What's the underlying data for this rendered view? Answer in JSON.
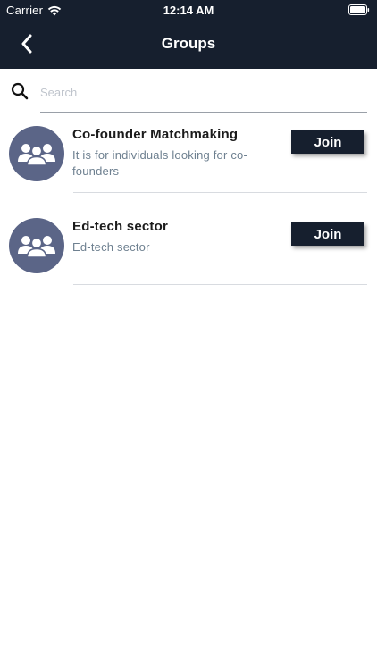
{
  "status_bar": {
    "carrier": "Carrier",
    "time": "12:14 AM",
    "wifi_icon": "wifi-icon",
    "battery_icon": "battery-icon"
  },
  "nav": {
    "title": "Groups",
    "back_icon": "chevron-left-icon"
  },
  "search": {
    "placeholder": "Search",
    "value": "",
    "icon": "search-icon"
  },
  "groups": [
    {
      "name": "Co-founder Matchmaking",
      "description": "It is for individuals looking for co-founders",
      "join_label": "Join",
      "avatar_icon": "group-icon"
    },
    {
      "name": "Ed-tech sector",
      "description": "Ed-tech sector",
      "join_label": "Join",
      "avatar_icon": "group-icon"
    }
  ],
  "colors": {
    "header_bg": "#161f2e",
    "avatar_bg": "#5b6587",
    "description_text": "#6e8090",
    "button_bg": "#161f2e"
  }
}
